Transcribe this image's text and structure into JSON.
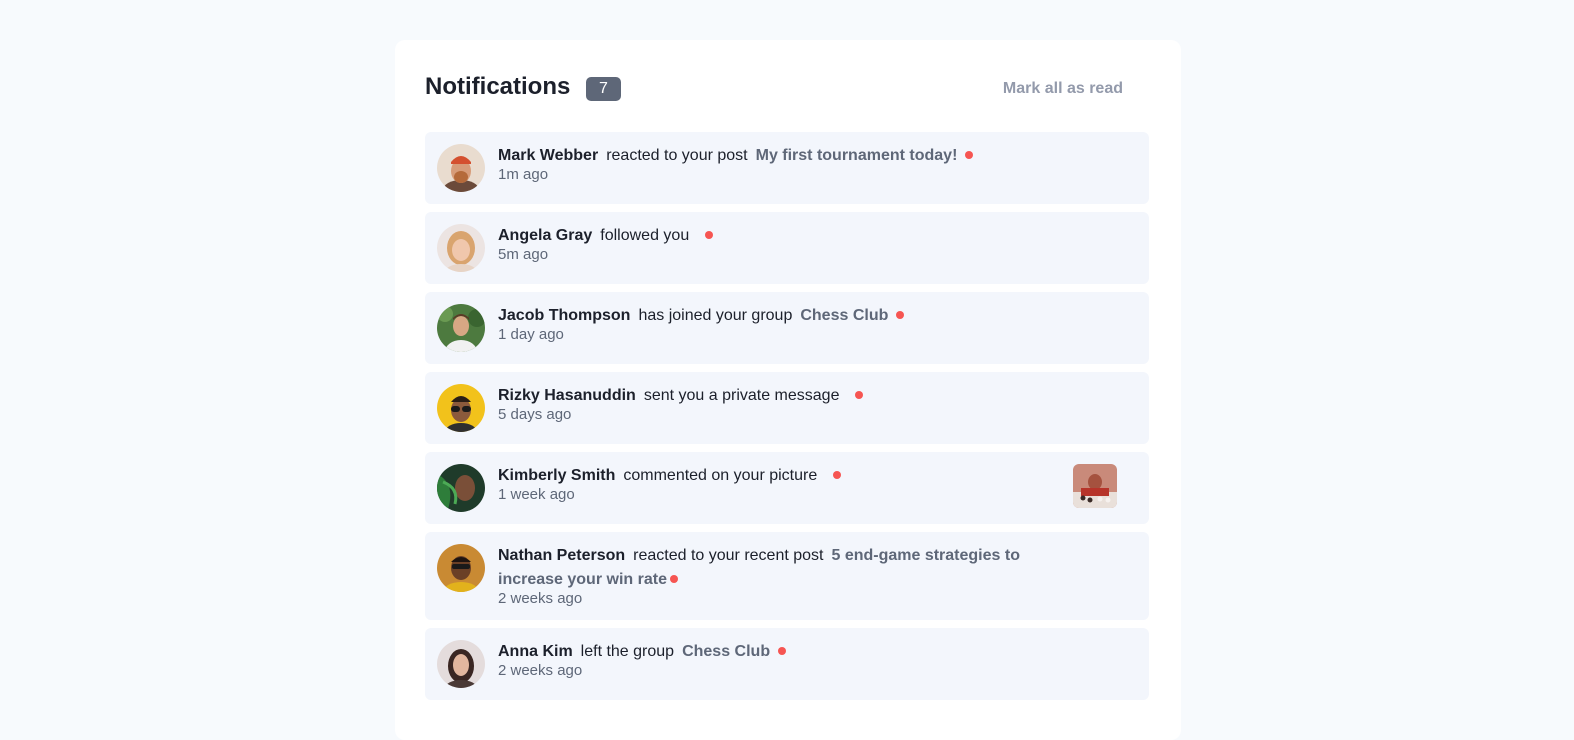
{
  "header": {
    "title": "Notifications",
    "unread_count": "7",
    "mark_all_label": "Mark all as read"
  },
  "colors": {
    "unread_dot": "#f65552",
    "item_bg": "#f3f6fc",
    "badge_bg": "#5e6778"
  },
  "notifications": [
    {
      "name": "Mark Webber",
      "action": "reacted to your post",
      "target": "My first tournament today!",
      "time": "1m ago",
      "unread": true
    },
    {
      "name": "Angela Gray",
      "action": "followed you",
      "target": "",
      "time": "5m ago",
      "unread": true
    },
    {
      "name": "Jacob Thompson",
      "action": "has joined your group",
      "target": "Chess Club",
      "time": "1 day ago",
      "unread": true
    },
    {
      "name": "Rizky Hasanuddin",
      "action": "sent you a private message",
      "target": "",
      "time": "5 days ago",
      "unread": true
    },
    {
      "name": "Kimberly Smith",
      "action": "commented on your picture",
      "target": "",
      "time": "1 week ago",
      "unread": true,
      "thumbnail": "chess-picture"
    },
    {
      "name": "Nathan Peterson",
      "action": "reacted to your recent post",
      "target": "5 end-game strategies to increase your win rate",
      "time": "2 weeks ago",
      "unread": true
    },
    {
      "name": "Anna Kim",
      "action": "left the group",
      "target": "Chess Club",
      "time": "2 weeks ago",
      "unread": true
    }
  ]
}
